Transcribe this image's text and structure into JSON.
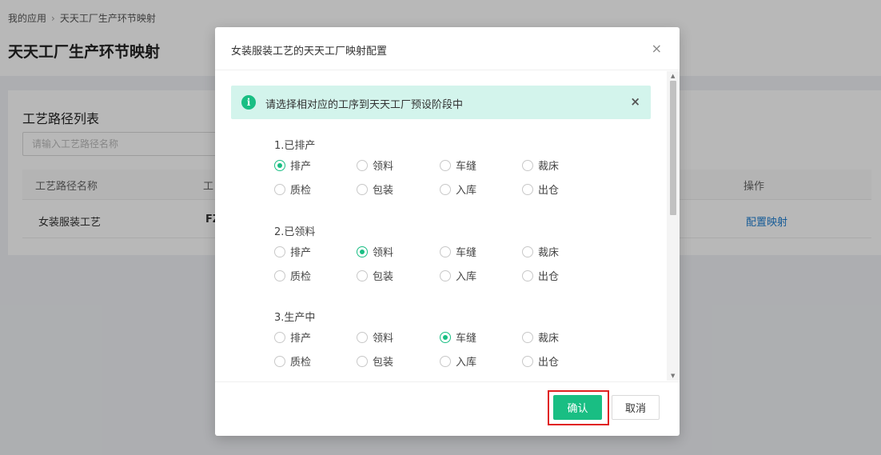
{
  "breadcrumb": {
    "items": [
      "我的应用",
      "天天工厂生产环节映射"
    ],
    "separator": "›"
  },
  "page": {
    "title": "天天工厂生产环节映射"
  },
  "list": {
    "title": "工艺路径列表",
    "search_placeholder": "请输入工艺路径名称",
    "columns": [
      "工艺路径名称",
      "工",
      "操作"
    ],
    "rows": [
      {
        "name": "女装服装工艺",
        "code": "FZ",
        "action": "配置映射"
      }
    ]
  },
  "modal": {
    "title": "女装服装工艺的天天工厂映射配置",
    "close_icon": "×",
    "alert": {
      "icon": "info-icon",
      "icon_glyph": "i",
      "text": "请选择相对应的工序到天天工厂预设阶段中",
      "close_icon": "×"
    },
    "groups": [
      {
        "title": "1.已排产",
        "options": [
          "排产",
          "领料",
          "车缝",
          "裁床",
          "质检",
          "包装",
          "入库",
          "出仓"
        ],
        "selected": "排产"
      },
      {
        "title": "2.已领料",
        "options": [
          "排产",
          "领料",
          "车缝",
          "裁床",
          "质检",
          "包装",
          "入库",
          "出仓"
        ],
        "selected": "领料"
      },
      {
        "title": "3.生产中",
        "options": [
          "排产",
          "领料",
          "车缝",
          "裁床",
          "质检",
          "包装",
          "入库",
          "出仓"
        ],
        "selected": "车缝"
      }
    ],
    "confirm_label": "确认",
    "cancel_label": "取消"
  },
  "colors": {
    "accent": "#19be83",
    "alert_bg": "#d3f4ec",
    "link": "#1f7fd1",
    "highlight": "#e02020"
  }
}
